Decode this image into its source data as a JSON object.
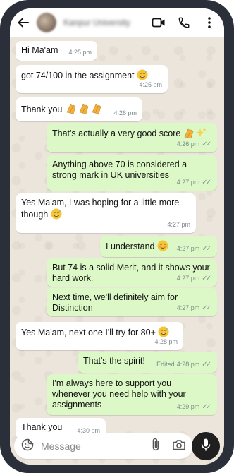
{
  "header": {
    "contact_name": "Kanpur University",
    "icons": [
      "back-arrow-icon",
      "video-call-icon",
      "phone-icon",
      "more-options-icon"
    ]
  },
  "messages": [
    {
      "dir": "in",
      "text": "Hi Ma'am",
      "time": "4:25 pm"
    },
    {
      "dir": "in",
      "text": "got 74/100 in the assignment",
      "emoji": "grinning-sweat",
      "time": "4:25 pm"
    },
    {
      "dir": "in",
      "text": "Thank you",
      "emoji": "clapping-hands x3",
      "time": "4:26 pm"
    },
    {
      "dir": "out",
      "text": "That's actually a very good score",
      "emoji": "clapping-sparkles",
      "time": "4:26 pm",
      "status": "read"
    },
    {
      "dir": "out",
      "text": "Anything above 70 is considered a strong mark in UK universities",
      "time": "4:27 pm",
      "status": "read"
    },
    {
      "dir": "in",
      "text": "Yes Ma'am, I was hoping for a little more though",
      "emoji": "grinning-sweat",
      "time": "4:27 pm"
    },
    {
      "dir": "out",
      "text": "I understand",
      "emoji": "smiling-face",
      "time": "4:27 pm",
      "status": "read"
    },
    {
      "dir": "out",
      "text": "But 74 is a solid Merit, and it shows your hard work.",
      "time": "4:27 pm",
      "status": "read"
    },
    {
      "dir": "out",
      "text": "Next time, we'll definitely aim for Distinction",
      "time": "4:27 pm",
      "status": "read"
    },
    {
      "dir": "in",
      "text": "Yes Ma'am, next one I'll try for 80+",
      "emoji": "grinning-sweat",
      "time": "4:28 pm"
    },
    {
      "dir": "out",
      "text": "That's the spirit!",
      "edited": "Edited",
      "time": "4:28 pm",
      "status": "read"
    },
    {
      "dir": "out",
      "text": "I'm always here to support you whenever you need help with your assignments",
      "time": "4:29 pm",
      "status": "read"
    },
    {
      "dir": "in",
      "text": "Thank you",
      "time": "4:30 pm"
    }
  ],
  "input": {
    "placeholder": "Message",
    "icons": [
      "sticker-icon",
      "attach-icon",
      "camera-icon",
      "mic-icon"
    ]
  },
  "colors": {
    "incoming_bubble": "#ffffff",
    "outgoing_bubble": "#dcf8c6",
    "chat_background": "#ece5dc",
    "phone_frame": "#2b2f3a"
  }
}
